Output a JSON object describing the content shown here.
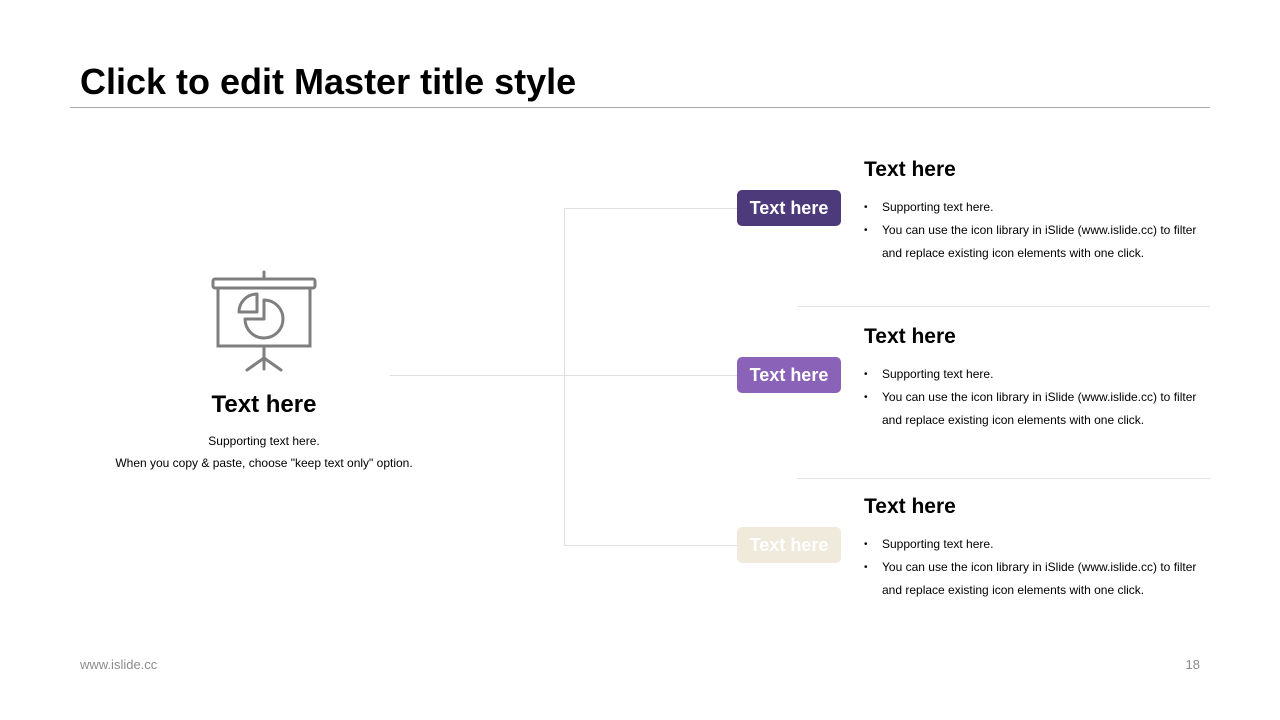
{
  "slide": {
    "title": "Click to edit Master title style",
    "footer_left": "www.islide.cc",
    "page_number": "18"
  },
  "hub": {
    "icon": "presentation-board-pie-chart-icon",
    "title": "Text here",
    "lines": [
      "Supporting text here.",
      "When you copy & paste, choose \"keep text only\" option."
    ]
  },
  "colors": {
    "pill_1": "#4d3a7a",
    "pill_2": "#8a63b8",
    "pill_3": "#efeadb",
    "icon": "#7f7f7f",
    "connector": "#e0e0e0"
  },
  "items": [
    {
      "pill_label": "Text here",
      "title": "Text here",
      "bullets": [
        "Supporting text here.",
        "You can use the icon library in iSlide  (www.islide.cc) to filter and replace existing icon elements with one click."
      ]
    },
    {
      "pill_label": "Text here",
      "title": "Text here",
      "bullets": [
        "Supporting text here.",
        "You can use the icon library in iSlide  (www.islide.cc) to filter and replace existing icon elements with one click."
      ]
    },
    {
      "pill_label": "Text here",
      "title": "Text here",
      "bullets": [
        "Supporting text here.",
        "You can use the icon library in iSlide  (www.islide.cc) to filter and replace existing icon elements with one click."
      ]
    }
  ]
}
